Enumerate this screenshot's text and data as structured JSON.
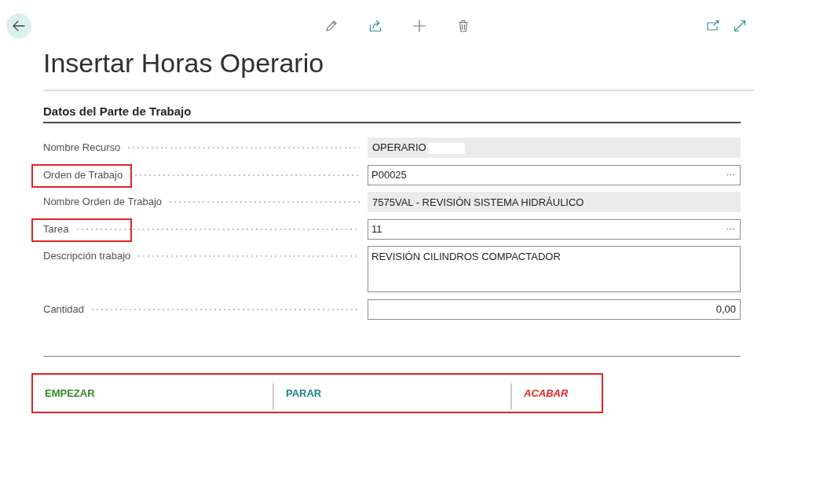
{
  "page": {
    "title": "Insertar Horas Operario"
  },
  "section": {
    "title": "Datos del Parte de Trabajo"
  },
  "fields": [
    {
      "label": "Nombre Recurso",
      "kind": "readonly",
      "value": "OPERARIO",
      "redacted": true,
      "highlighted": false
    },
    {
      "label": "Orden de Trabajo",
      "kind": "lookup",
      "value": "P00025",
      "redacted": false,
      "highlighted": true
    },
    {
      "label": "Nombre Orden de Trabajo",
      "kind": "readonly",
      "value": "7575VAL - REVISIÓN SISTEMA HIDRÁULICO",
      "redacted": false,
      "highlighted": false
    },
    {
      "label": "Tarea",
      "kind": "lookup",
      "value": "11",
      "redacted": false,
      "highlighted": true
    },
    {
      "label": "Descripción trabajo",
      "kind": "multiline",
      "value": "REVISIÓN CILINDROS COMPACTADOR",
      "redacted": false,
      "highlighted": false
    },
    {
      "label": "Cantidad",
      "kind": "number",
      "value": "0,00",
      "redacted": false,
      "highlighted": false
    }
  ],
  "actions": {
    "highlighted": true,
    "items": [
      {
        "label": "EMPEZAR",
        "color": "#2f8a22",
        "italic": false
      },
      {
        "label": "PARAR",
        "color": "#17858a",
        "italic": false
      },
      {
        "label": "ACABAR",
        "color": "#e52420",
        "italic": true
      }
    ]
  }
}
